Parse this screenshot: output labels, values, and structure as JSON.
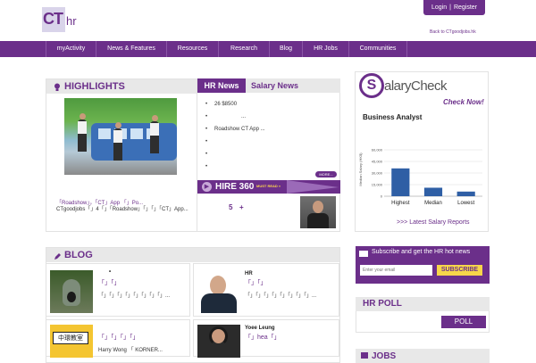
{
  "header": {
    "logo_ct": "CT",
    "logo_hr": "hr",
    "login": "Login",
    "divider": "|",
    "register": "Register",
    "back_link": "Back to CTgoodjobs.hk"
  },
  "nav": {
    "items": [
      "myActivity",
      "News & Features",
      "Resources",
      "Research",
      "Blog",
      "HR Jobs",
      "Communities"
    ]
  },
  "highlights": {
    "title": "HIGHLIGHTS",
    "caption_link": "「Roadshow」，「CT」App 「」Po...",
    "caption_body": "CTgoodjobs「」4「」「Roadshow」「」「」「CT」App..."
  },
  "news_tabs": {
    "active": "HR News",
    "inactive": "Salary News"
  },
  "news_items": [
    "26 $8500",
    "...",
    "Roadshow CT App ...",
    "",
    "",
    ""
  ],
  "more_label": "MORE...",
  "hire": {
    "title": "HIRE 360",
    "read_more": "MUST READ »",
    "pager_num": "5",
    "pager_plus": "+"
  },
  "salary": {
    "logo_s": "S",
    "logo_rest": "alaryCheck",
    "check_now": "Check Now!",
    "job_title": "Business Analyst",
    "latest_link": ">>> Latest Salary Reports"
  },
  "chart_data": {
    "type": "bar",
    "categories": [
      "Highest",
      "Median",
      "Lowest"
    ],
    "values": [
      36000,
      11000,
      6000
    ],
    "ylabel": "Median Salary (HK$)",
    "ylim": [
      0,
      60000
    ],
    "ticks": [
      "0",
      "15,000",
      "30,000",
      "45,000",
      "60,000"
    ],
    "bar_color": "#2f5fa5",
    "grid": true
  },
  "blog": {
    "title": "BLOG",
    "cards": [
      {
        "author": "•",
        "link": "「」「」",
        "excerpt": "「」「」「」「」「」「」「」「」..."
      },
      {
        "author": "HR",
        "link": "「」「」",
        "excerpt": "「」「」「」「」「」「」「」「」..."
      },
      {
        "author": "",
        "link": "「」「」「」「」",
        "excerpt": "Harry Wong 「 KORNER..."
      },
      {
        "author": "Yoee Leung",
        "link": "「」hea「」",
        "excerpt": ""
      }
    ],
    "sign_text": "中環教室"
  },
  "subscribe": {
    "text": "Subscribe and get the HR hot news",
    "placeholder": "Enter your email",
    "button": "SUBSCRIBE"
  },
  "poll": {
    "title": "HR POLL",
    "button": "POLL"
  },
  "jobs": {
    "title": "JOBS"
  }
}
